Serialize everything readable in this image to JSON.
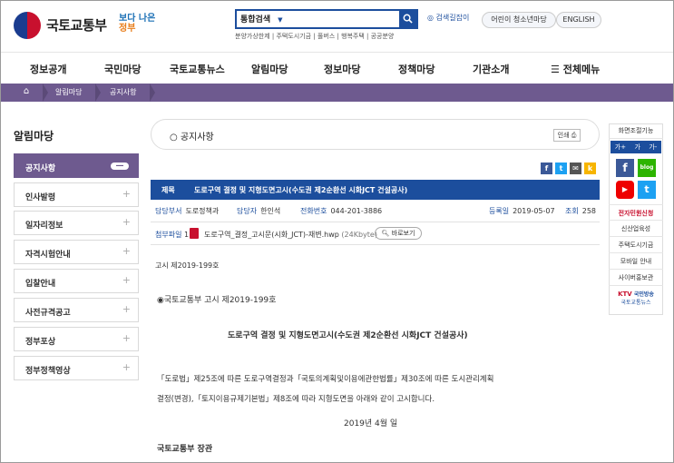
{
  "header": {
    "logo_text": "국토교통부",
    "slogan_line1": "보다 나은",
    "slogan_line2": "정부",
    "search_category": "통합검색",
    "search_guide": "검색길잡이",
    "quick_links": "분양가상한제 | 주택도시기금 | 풀버스 | 행복주택 | 공공분양",
    "kids_link": "어린이 청소년마당",
    "english_link": "ENGLISH"
  },
  "gnb": [
    "정보공개",
    "국민마당",
    "국토교통뉴스",
    "알림마당",
    "정보마당",
    "정책마당",
    "기관소개"
  ],
  "gnb_all_menu": "전체메뉴",
  "breadcrumb": [
    "알림마당",
    "공지사항"
  ],
  "lnb": {
    "title": "알림마당",
    "items": [
      "공지사항",
      "인사발령",
      "일자리정보",
      "자격시험안내",
      "입찰안내",
      "사전규격공고",
      "정부포상",
      "정부정책영상"
    ]
  },
  "page": {
    "title": "공지사항",
    "print_label": "인쇄"
  },
  "post": {
    "title_label": "제목",
    "title": "도로구역 결정 및 지형도면고시(수도권 제2순환선 시화JCT 건설공사)",
    "dept_label": "담당부서",
    "dept": "도로정책과",
    "person_label": "담당자",
    "person": "한인석",
    "phone_label": "전화번호",
    "phone": "044-201-3886",
    "date_label": "등록일",
    "date": "2019-05-07",
    "views_label": "조회",
    "views": "258",
    "attach_label": "첨부파일",
    "attach_count": "1",
    "attach_name": "도로구역_결정_고시문(시화_JCT)-재변.hwp",
    "attach_size": "(24Kbyte)",
    "view_button": "바로보기",
    "notice_no": "고시 제2019-199호",
    "notice_heading": "◉국토교통부 고시 제2019-199호",
    "body_title": "도로구역 결정 및 지형도면고시(수도권 제2순환선 시화JCT 건설공사)",
    "body_line1": "「도로법」제25조에 따른 도로구역결정과「국토의계획및이용에관한법률」제30조에 따른 도시관리계획",
    "body_line2": "결정(변경),「토지이용규제기본법」제8조에 따라 지형도면을 아래와 같이 고시합니다.",
    "body_date": "2019년 4월  일",
    "signature": "국토교통부 장관"
  },
  "right_panel": {
    "zoom_label": "화면조절기능",
    "zoom_in": "가+",
    "zoom_reset": "가",
    "zoom_out": "가-",
    "blog_label": "blog",
    "links": [
      "전자민원신청",
      "신산업육성",
      "주택도시기금",
      "모바일 안내",
      "사이버홍보관"
    ],
    "ktv_label": "KTV",
    "ktv_sub": "국민방송",
    "ktv_text": "국토교통뉴스"
  },
  "colors": {
    "brand_blue": "#1c4e9d",
    "purple": "#6e5a8f",
    "accent_red": "#c8102e"
  }
}
